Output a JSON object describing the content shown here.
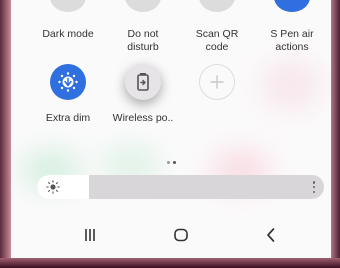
{
  "quick_panel": {
    "row1": [
      {
        "label": "Dark mode",
        "icon": "moon-icon"
      },
      {
        "label": "Do not\ndisturb",
        "icon": "minus-circle-icon"
      },
      {
        "label": "Scan QR\ncode",
        "icon": "qr-code-icon"
      },
      {
        "label": "S Pen air\nactions",
        "icon": "pen-icon"
      }
    ],
    "row2": [
      {
        "label": "Extra dim",
        "icon": "extra-dim-icon",
        "active": true
      },
      {
        "label": "Wireless po..",
        "icon": "wireless-powershare-icon",
        "active": false
      },
      {
        "label": "",
        "icon": "plus-icon"
      }
    ],
    "page_indicator": {
      "pages": 2,
      "current": 2
    },
    "brightness": {
      "level": 0.18,
      "icon": "sun-icon",
      "menu_icon": "more-vertical-icon"
    }
  },
  "nav_bar": {
    "recents_icon": "recents-icon",
    "home_icon": "home-icon",
    "back_icon": "back-icon"
  },
  "colors": {
    "accent_blue": "#2f6fe0",
    "panel_bg": "#fbfafb",
    "slider_track": "#d8d6d8"
  }
}
